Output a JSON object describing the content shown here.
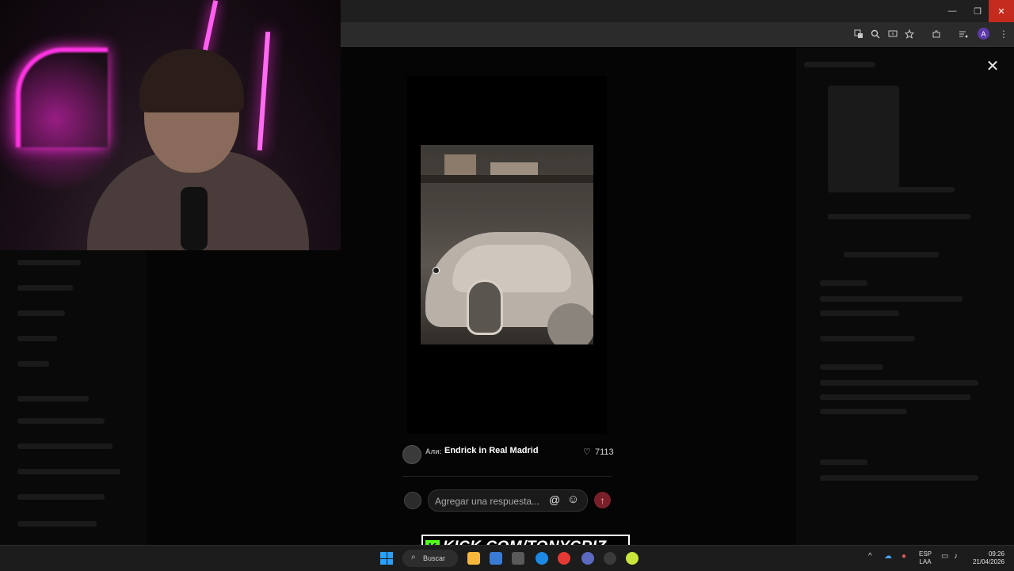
{
  "browser": {
    "window_controls": {
      "minimize": "—",
      "restore": "❐",
      "close": "✕"
    },
    "toolbar_icons": [
      "translate-icon",
      "zoom-icon",
      "install-icon",
      "star-icon",
      "extensions-icon",
      "media-icon",
      "profile-avatar",
      "menu-icon"
    ],
    "profile_initial": "A"
  },
  "modal": {
    "close_glyph": "✕",
    "post": {
      "author": "Али:",
      "title": "Endrick in Real Madrid",
      "likes": "7113"
    },
    "reply": {
      "placeholder": "Agregar una respuesta...",
      "at_glyph": "@",
      "emoji_glyph": "☺",
      "send_glyph": "↑"
    }
  },
  "overlay": {
    "kick_logo": "K",
    "kick_text": "KICK.COM/TONYCRIZ"
  },
  "taskbar": {
    "search_label": "Buscar",
    "language_top": "ESP",
    "language_bottom": "LAA",
    "time": "09:26",
    "date": "21/04/2026",
    "tray_chevron": "^"
  },
  "colors": {
    "accent_kick": "#53fc18",
    "send_button": "#7a1f2a",
    "windows_blue": "#2aa0ff",
    "close_red": "#c42b1c"
  }
}
